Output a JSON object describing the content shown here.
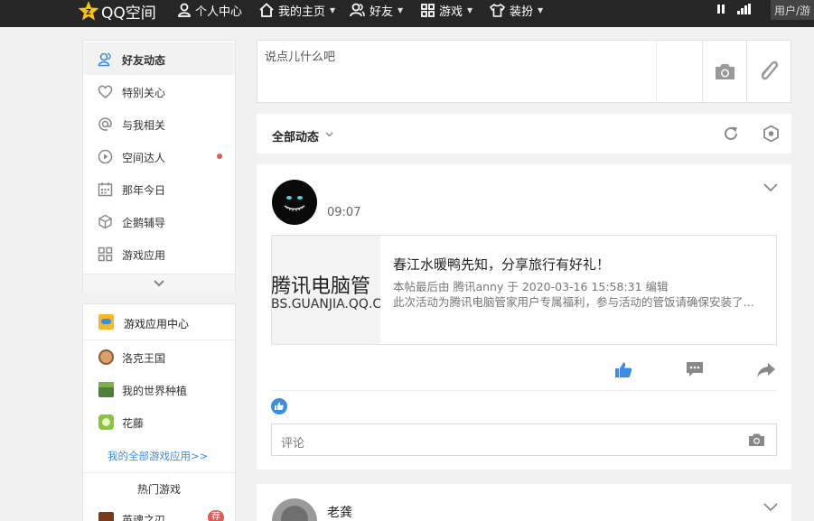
{
  "topnav": {
    "logo_text": "QQ空间",
    "items": [
      {
        "label": "个人中心",
        "icon": "person-icon"
      },
      {
        "label": "我的主页",
        "icon": "home-icon"
      },
      {
        "label": "好友",
        "icon": "friends-icon"
      },
      {
        "label": "游戏",
        "icon": "grid-icon"
      },
      {
        "label": "装扮",
        "icon": "shirt-icon"
      }
    ],
    "user_label": "用户/游"
  },
  "sidebar": {
    "items": [
      {
        "label": "好友动态",
        "icon": "friends-feed-icon",
        "active": true
      },
      {
        "label": "特别关心",
        "icon": "heart-icon"
      },
      {
        "label": "与我相关",
        "icon": "at-icon"
      },
      {
        "label": "空间达人",
        "icon": "play-circle-icon",
        "badge_dot": true
      },
      {
        "label": "那年今日",
        "icon": "calendar-icon"
      },
      {
        "label": "企鹅辅导",
        "icon": "cube-icon"
      },
      {
        "label": "游戏应用",
        "icon": "apps-icon"
      }
    ]
  },
  "games": {
    "header": "游戏应用中心",
    "items": [
      {
        "label": "洛克王国"
      },
      {
        "label": "我的世界种植"
      },
      {
        "label": "花藤"
      }
    ],
    "all_link": "我的全部游戏应用>>",
    "hot_title": "热门游戏",
    "hot_item": "英魂之刃",
    "hot_badge": "荐"
  },
  "composer": {
    "placeholder": "说点儿什么吧"
  },
  "feed_filter": {
    "label": "全部动态"
  },
  "post": {
    "time": "09:07",
    "link_card": {
      "thumb_cn": "腾讯电脑管",
      "thumb_en": "BS.GUANJIA.QQ.C",
      "title": "春江水暖鸭先知，分享旅行有好礼！",
      "meta": "本帖最后由 腾讯anny 于 2020-03-16 15:58:31 编辑",
      "desc": "此次活动为腾讯电脑管家用户专属福利，参与活动的管饭请确保安装了电脑管家"
    },
    "comment_placeholder": "评论"
  },
  "post2": {
    "author": "老龚"
  },
  "colors": {
    "accent": "#3c8de0",
    "topbar": "#262626",
    "logo_yellow": "#f6c21c",
    "badge_red": "#e05a5a"
  }
}
